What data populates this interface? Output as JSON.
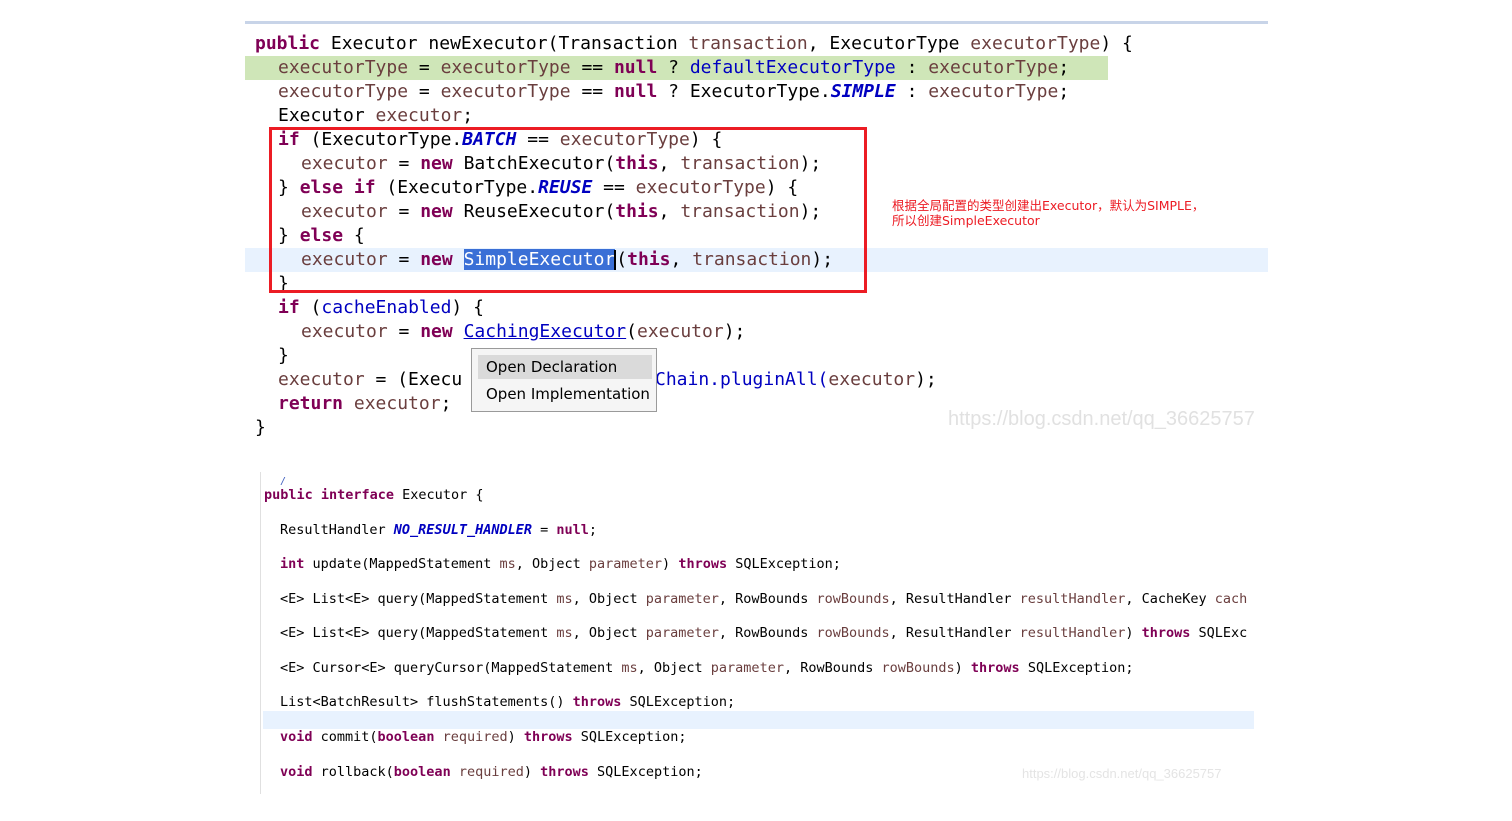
{
  "top_code": {
    "l1": {
      "a": "public",
      "b": " Executor newExecutor(Transaction ",
      "c": "transaction",
      ",": ", ExecutorType ",
      "d": "executorType",
      ")": ") {"
    },
    "l2": {
      "a": "executorType",
      "b": " = ",
      "c": "executorType",
      "d": " == ",
      "e": "null",
      "f": " ? ",
      "g": "defaultExecutorType",
      "h": " : ",
      "i": "executorType",
      "j": ";"
    },
    "l3": {
      "a": "executorType",
      "b": " = ",
      "c": "executorType",
      "d": " == ",
      "e": "null",
      "f": " ? ExecutorType.",
      "g": "SIMPLE",
      "h": " : ",
      "i": "executorType",
      "j": ";"
    },
    "l4": {
      "a": "Executor ",
      "b": "executor",
      "c": ";"
    },
    "l5": {
      "a": "if",
      "b": " (ExecutorType.",
      "c": "BATCH",
      "d": " == ",
      "e": "executorType",
      "f": ") {"
    },
    "l6": {
      "a": "executor",
      "b": " = ",
      "c": "new",
      "d": " BatchExecutor(",
      "e": "this",
      "f": ", ",
      "g": "transaction",
      "h": ");"
    },
    "l7": {
      "a": "} ",
      "b": "else if",
      "c": " (ExecutorType.",
      "d": "REUSE",
      "e": " == ",
      "f": "executorType",
      "g": ") {"
    },
    "l8": {
      "a": "executor",
      "b": " = ",
      "c": "new",
      "d": " ReuseExecutor(",
      "e": "this",
      "f": ", ",
      "g": "transaction",
      "h": ");"
    },
    "l9": {
      "a": "} ",
      "b": "else",
      "c": " {"
    },
    "l10": {
      "a": "executor",
      "b": " = ",
      "c": "new",
      "d": " ",
      "sel": "SimpleExecutor",
      "e": "(",
      "f": "this",
      "g": ", ",
      "h": "transaction",
      "i": ");"
    },
    "l11": {
      "a": "}"
    },
    "l12": {
      "a": "if",
      "b": " (",
      "c": "cacheEnabled",
      "d": ") {"
    },
    "l13": {
      "a": "executor",
      "b": " = ",
      "c": "new",
      "d": " ",
      "e": "CachingExecutor",
      "f": "(",
      "g": "executor",
      "h": ");"
    },
    "l14": {
      "a": "}"
    },
    "l15": {
      "a": "executor",
      "b": " = (Execu",
      "c": "Chain.pluginAll(",
      "d": "executor",
      "e": ");"
    },
    "l16": {
      "a": "return",
      "b": " ",
      "c": "executor",
      "d": ";"
    },
    "l17": {
      "a": "}"
    }
  },
  "annotation": {
    "line1": "根据全局配置的类型创建出Executor，默认为SIMPLE，",
    "line2": "所以创建SimpleExecutor"
  },
  "context_menu": {
    "items": [
      "Open Declaration",
      "Open Implementation"
    ]
  },
  "watermark": "https://blog.csdn.net/qq_36625757",
  "bottom_code": {
    "b0": "/",
    "b1": {
      "a": "public interface",
      "b": " Executor {"
    },
    "b2": {
      "a": "ResultHandler ",
      "b": "NO_RESULT_HANDLER",
      "c": " = ",
      "d": "null",
      "e": ";"
    },
    "b3": {
      "a": "int",
      "b": " update(MappedStatement ",
      "c": "ms",
      ",": ", Object ",
      "d": "parameter",
      "e": ") ",
      "f": "throws",
      "g": " SQLException;"
    },
    "b4": {
      "a": "<E> List<E> query(MappedStatement ",
      "b": "ms",
      "c": ", Object ",
      "d": "parameter",
      "e": ", RowBounds ",
      "f": "rowBounds",
      "g": ", ResultHandler ",
      "h": "resultHandler",
      "i": ", CacheKey ",
      "j": "cach"
    },
    "b5": {
      "a": "<E> List<E> query(MappedStatement ",
      "b": "ms",
      "c": ", Object ",
      "d": "parameter",
      "e": ", RowBounds ",
      "f": "rowBounds",
      "g": ", ResultHandler ",
      "h": "resultHandler",
      "i": ") ",
      "j": "throws",
      "k": " SQLExc"
    },
    "b6": {
      "a": "<E> Cursor<E> queryCursor(MappedStatement ",
      "b": "ms",
      "c": ", Object ",
      "d": "parameter",
      "e": ", RowBounds ",
      "f": "rowBounds",
      "g": ") ",
      "h": "throws",
      "i": " SQLException;"
    },
    "b7": {
      "a": "List<BatchResult> flushStatements() ",
      "b": "throws",
      "c": " SQLException;"
    },
    "b8": {
      "a": "void",
      "b": " commit(",
      "c": "boolean",
      "d": " ",
      "e": "required",
      "f": ") ",
      "g": "throws",
      "h": " SQLException;"
    },
    "b9": {
      "a": "void",
      "b": " rollback(",
      "c": "boolean",
      "d": " ",
      "e": "required",
      "f": ") ",
      "g": "throws",
      "h": " SQLException;"
    }
  }
}
